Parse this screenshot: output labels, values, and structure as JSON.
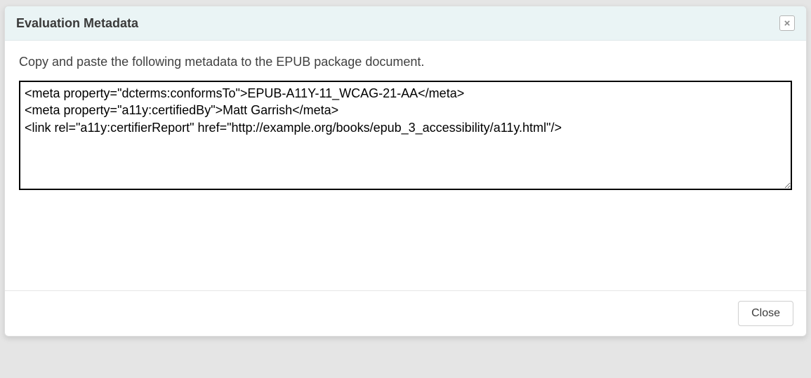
{
  "dialog": {
    "title": "Evaluation Metadata",
    "instruction": "Copy and paste the following metadata to the EPUB package document.",
    "textarea_value": "<meta property=\"dcterms:conformsTo\">EPUB-A11Y-11_WCAG-21-AA</meta>\n<meta property=\"a11y:certifiedBy\">Matt Garrish</meta>\n<link rel=\"a11y:certifierReport\" href=\"http://example.org/books/epub_3_accessibility/a11y.html\"/>\n",
    "close_button_label": "Close",
    "close_x_label": "×"
  }
}
